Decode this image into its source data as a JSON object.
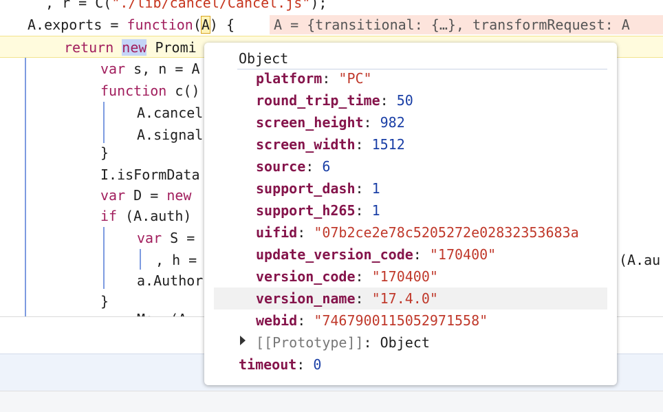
{
  "code": {
    "line0_a": ", r = C(",
    "line0_str": "\"./lib/cancel/Cancel.js\"",
    "line0_b": ");",
    "line1_a": "A.exports = ",
    "line1_kw": "function",
    "line1_b": "(",
    "line1_tok": "A",
    "line1_c": ") {",
    "line1_inline": "A = {transitional: {…}, transformRequest: A",
    "line2_kw": "return",
    "line2_sel": "new",
    "line2_rest": " Promi",
    "line3_kw": "var",
    "line3_rest": " s, n = A",
    "line4_kw": "function",
    "line4_rest": " c()",
    "line5": "A.cancel",
    "line6": "A.signal",
    "line7": "}",
    "line8": "I.isFormData",
    "line9_kw": "var",
    "line9_a": " D = ",
    "line9_kw2": "new",
    "line10_kw": "if",
    "line10_rest": " (A.auth)",
    "line11_kw": "var",
    "line11_rest": " S =",
    "line12": ", h =",
    "line12_right": "(A.au",
    "line13": "a.Author",
    "line14": "}",
    "line15": "Mo  (A"
  },
  "popover": {
    "title": "Object",
    "properties": [
      {
        "key": "platform",
        "value": "\"PC\"",
        "kind": "string"
      },
      {
        "key": "round_trip_time",
        "value": "50",
        "kind": "number"
      },
      {
        "key": "screen_height",
        "value": "982",
        "kind": "number"
      },
      {
        "key": "screen_width",
        "value": "1512",
        "kind": "number"
      },
      {
        "key": "source",
        "value": "6",
        "kind": "number"
      },
      {
        "key": "support_dash",
        "value": "1",
        "kind": "number"
      },
      {
        "key": "support_h265",
        "value": "1",
        "kind": "number"
      },
      {
        "key": "uifid",
        "value": "\"07b2ce2e78c5205272e02832353683a",
        "kind": "string"
      },
      {
        "key": "update_version_code",
        "value": "\"170400\"",
        "kind": "string"
      },
      {
        "key": "version_code",
        "value": "\"170400\"",
        "kind": "string"
      },
      {
        "key": "version_name",
        "value": "\"17.4.0\"",
        "kind": "string"
      },
      {
        "key": "webid",
        "value": "\"7467900115052971558\"",
        "kind": "string"
      }
    ],
    "hovered_index": 10,
    "prototype_label": "[[Prototype]]",
    "prototype_value": "Object",
    "timeout_key": "timeout",
    "timeout_value": "0"
  }
}
